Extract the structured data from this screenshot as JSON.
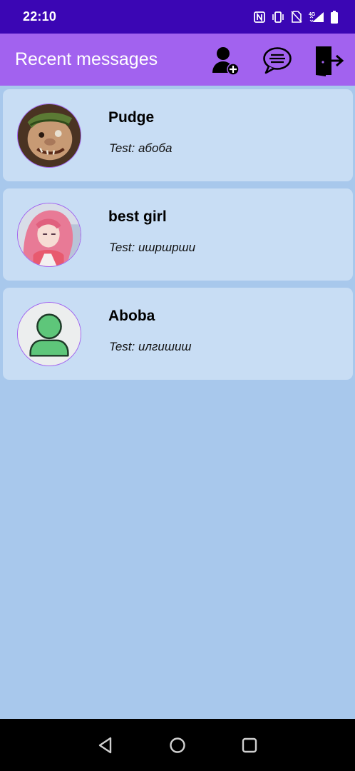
{
  "status_bar": {
    "time": "22:10",
    "network_label": "4G"
  },
  "app_bar": {
    "title": "Recent messages",
    "actions": [
      {
        "icon": "add-user-icon"
      },
      {
        "icon": "chat-bubble-icon"
      },
      {
        "icon": "logout-icon"
      }
    ]
  },
  "conversations": [
    {
      "name": "Pudge",
      "preview": "Test: абоба",
      "avatar": "pudge-avatar"
    },
    {
      "name": "best girl",
      "preview": "Test: ишршрши",
      "avatar": "anime-girl-avatar"
    },
    {
      "name": "Aboba",
      "preview": "Test: илгишиш",
      "avatar": "default-user-avatar"
    }
  ],
  "colors": {
    "status_bar": "#3b06b4",
    "app_bar": "#a262ef",
    "background": "#a8c8ec",
    "card": "#c8ddf4",
    "default_avatar_green": "#5ec67a"
  }
}
